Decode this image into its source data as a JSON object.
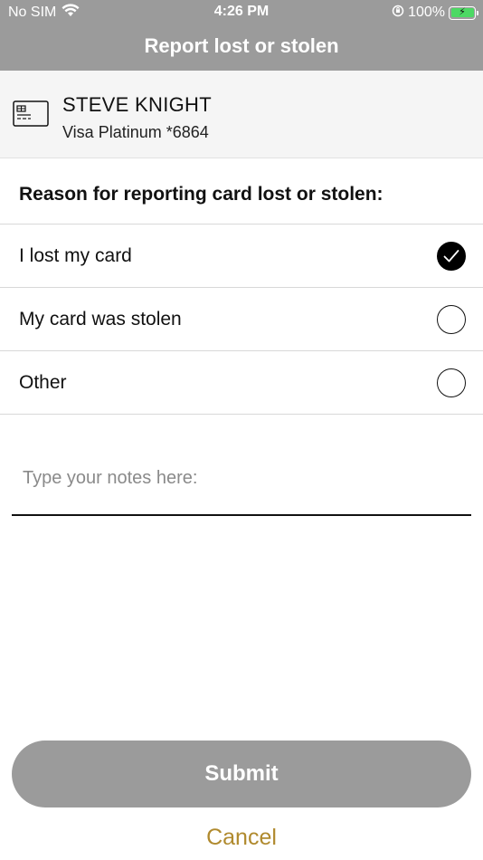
{
  "status_bar": {
    "carrier": "No SIM",
    "time": "4:26 PM",
    "battery": "100%"
  },
  "header": {
    "title": "Report lost or stolen"
  },
  "card": {
    "holder_name": "STEVE KNIGHT",
    "card_type": "Visa Platinum *6864"
  },
  "reason": {
    "heading": "Reason for reporting card lost or stolen:",
    "options": [
      {
        "label": "I lost my card",
        "selected": true
      },
      {
        "label": "My card was stolen",
        "selected": false
      },
      {
        "label": "Other",
        "selected": false
      }
    ]
  },
  "notes": {
    "placeholder": "Type your notes here:",
    "value": ""
  },
  "actions": {
    "submit_label": "Submit",
    "cancel_label": "Cancel"
  },
  "colors": {
    "header_bg": "#9b9b9b",
    "button_bg": "#9b9b9b",
    "cancel_text": "#b08a2e",
    "battery_fill": "#4cd964"
  }
}
